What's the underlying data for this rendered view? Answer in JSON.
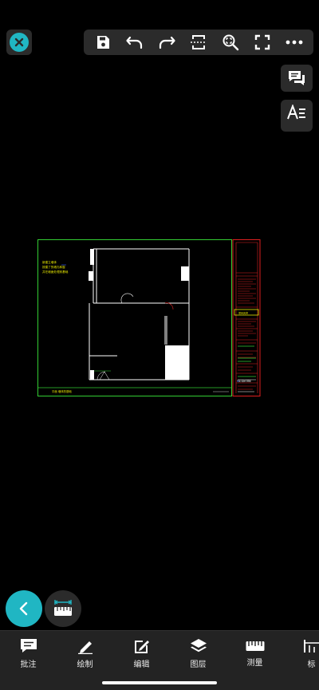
{
  "accent_color": "#20b6c3",
  "toolbar": {
    "icons": [
      "close-icon",
      "save-icon",
      "undo-icon",
      "redo-icon",
      "fit-width-icon",
      "zoom-window-icon",
      "fullscreen-icon",
      "more-icon"
    ]
  },
  "side_buttons": [
    "comment-list-icon",
    "text-style-icon"
  ],
  "drawing": {
    "notes": [
      "新建立墙体",
      "按建了的墙孔和窗",
      "并在墙面处理其基础"
    ],
    "footer_left": "平面   墙体的基础",
    "title_block": {
      "project_label": "项目名称",
      "drawing_name": "平面   墙体布置图"
    }
  },
  "bottom_tabs": [
    {
      "label": "批注",
      "icon": "annotate-icon"
    },
    {
      "label": "绘制",
      "icon": "pencil-icon"
    },
    {
      "label": "编辑",
      "icon": "edit-icon"
    },
    {
      "label": "图层",
      "icon": "layers-icon"
    },
    {
      "label": "测量",
      "icon": "ruler-icon"
    },
    {
      "label": "标",
      "icon": "dimension-icon"
    }
  ]
}
